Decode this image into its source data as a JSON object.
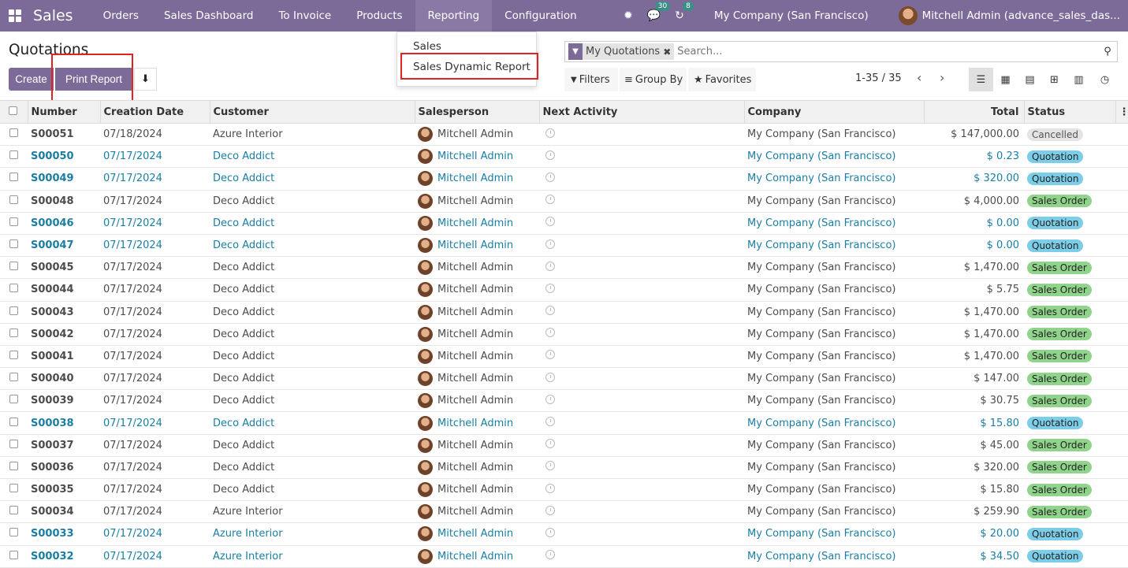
{
  "navbar": {
    "brand": "Sales",
    "menu": [
      "Orders",
      "Sales Dashboard",
      "To Invoice",
      "Products",
      "Reporting",
      "Configuration"
    ],
    "active_menu": "Reporting",
    "messages_count": "30",
    "activities_count": "8",
    "company": "My Company (San Francisco)",
    "user": "Mitchell Admin (advance_sales_das..."
  },
  "page": {
    "title": "Quotations",
    "create_label": "Create",
    "print_label": "Print Report"
  },
  "reporting_menu": {
    "items": [
      "Sales",
      "Sales Dynamic Report"
    ]
  },
  "search": {
    "facet": "My Quotations",
    "placeholder": "Search...",
    "filters_label": "Filters",
    "groupby_label": "Group By",
    "favorites_label": "Favorites"
  },
  "pager": {
    "text": "1-35 / 35"
  },
  "table": {
    "headers": [
      "Number",
      "Creation Date",
      "Customer",
      "Salesperson",
      "Next Activity",
      "Company",
      "Total",
      "Status"
    ],
    "rows": [
      {
        "number": "S00051",
        "date": "07/18/2024",
        "customer": "Azure Interior",
        "salesperson": "Mitchell Admin",
        "company": "My Company (San Francisco)",
        "total": "$ 147,000.00",
        "status": "Cancelled",
        "status_kind": "cancelled",
        "blue": false
      },
      {
        "number": "S00050",
        "date": "07/17/2024",
        "customer": "Deco Addict",
        "salesperson": "Mitchell Admin",
        "company": "My Company (San Francisco)",
        "total": "$ 0.23",
        "status": "Quotation",
        "status_kind": "quotation",
        "blue": true
      },
      {
        "number": "S00049",
        "date": "07/17/2024",
        "customer": "Deco Addict",
        "salesperson": "Mitchell Admin",
        "company": "My Company (San Francisco)",
        "total": "$ 320.00",
        "status": "Quotation",
        "status_kind": "quotation",
        "blue": true
      },
      {
        "number": "S00048",
        "date": "07/17/2024",
        "customer": "Deco Addict",
        "salesperson": "Mitchell Admin",
        "company": "My Company (San Francisco)",
        "total": "$ 4,000.00",
        "status": "Sales Order",
        "status_kind": "order",
        "blue": false
      },
      {
        "number": "S00046",
        "date": "07/17/2024",
        "customer": "Deco Addict",
        "salesperson": "Mitchell Admin",
        "company": "My Company (San Francisco)",
        "total": "$ 0.00",
        "status": "Quotation",
        "status_kind": "quotation",
        "blue": true
      },
      {
        "number": "S00047",
        "date": "07/17/2024",
        "customer": "Deco Addict",
        "salesperson": "Mitchell Admin",
        "company": "My Company (San Francisco)",
        "total": "$ 0.00",
        "status": "Quotation",
        "status_kind": "quotation",
        "blue": true
      },
      {
        "number": "S00045",
        "date": "07/17/2024",
        "customer": "Deco Addict",
        "salesperson": "Mitchell Admin",
        "company": "My Company (San Francisco)",
        "total": "$ 1,470.00",
        "status": "Sales Order",
        "status_kind": "order",
        "blue": false
      },
      {
        "number": "S00044",
        "date": "07/17/2024",
        "customer": "Deco Addict",
        "salesperson": "Mitchell Admin",
        "company": "My Company (San Francisco)",
        "total": "$ 5.75",
        "status": "Sales Order",
        "status_kind": "order",
        "blue": false
      },
      {
        "number": "S00043",
        "date": "07/17/2024",
        "customer": "Deco Addict",
        "salesperson": "Mitchell Admin",
        "company": "My Company (San Francisco)",
        "total": "$ 1,470.00",
        "status": "Sales Order",
        "status_kind": "order",
        "blue": false
      },
      {
        "number": "S00042",
        "date": "07/17/2024",
        "customer": "Deco Addict",
        "salesperson": "Mitchell Admin",
        "company": "My Company (San Francisco)",
        "total": "$ 1,470.00",
        "status": "Sales Order",
        "status_kind": "order",
        "blue": false
      },
      {
        "number": "S00041",
        "date": "07/17/2024",
        "customer": "Deco Addict",
        "salesperson": "Mitchell Admin",
        "company": "My Company (San Francisco)",
        "total": "$ 1,470.00",
        "status": "Sales Order",
        "status_kind": "order",
        "blue": false
      },
      {
        "number": "S00040",
        "date": "07/17/2024",
        "customer": "Deco Addict",
        "salesperson": "Mitchell Admin",
        "company": "My Company (San Francisco)",
        "total": "$ 147.00",
        "status": "Sales Order",
        "status_kind": "order",
        "blue": false
      },
      {
        "number": "S00039",
        "date": "07/17/2024",
        "customer": "Deco Addict",
        "salesperson": "Mitchell Admin",
        "company": "My Company (San Francisco)",
        "total": "$ 30.75",
        "status": "Sales Order",
        "status_kind": "order",
        "blue": false
      },
      {
        "number": "S00038",
        "date": "07/17/2024",
        "customer": "Deco Addict",
        "salesperson": "Mitchell Admin",
        "company": "My Company (San Francisco)",
        "total": "$ 15.80",
        "status": "Quotation",
        "status_kind": "quotation",
        "blue": true
      },
      {
        "number": "S00037",
        "date": "07/17/2024",
        "customer": "Deco Addict",
        "salesperson": "Mitchell Admin",
        "company": "My Company (San Francisco)",
        "total": "$ 45.00",
        "status": "Sales Order",
        "status_kind": "order",
        "blue": false
      },
      {
        "number": "S00036",
        "date": "07/17/2024",
        "customer": "Deco Addict",
        "salesperson": "Mitchell Admin",
        "company": "My Company (San Francisco)",
        "total": "$ 320.00",
        "status": "Sales Order",
        "status_kind": "order",
        "blue": false
      },
      {
        "number": "S00035",
        "date": "07/17/2024",
        "customer": "Deco Addict",
        "salesperson": "Mitchell Admin",
        "company": "My Company (San Francisco)",
        "total": "$ 15.80",
        "status": "Sales Order",
        "status_kind": "order",
        "blue": false
      },
      {
        "number": "S00034",
        "date": "07/17/2024",
        "customer": "Azure Interior",
        "salesperson": "Mitchell Admin",
        "company": "My Company (San Francisco)",
        "total": "$ 259.90",
        "status": "Sales Order",
        "status_kind": "order",
        "blue": false
      },
      {
        "number": "S00033",
        "date": "07/17/2024",
        "customer": "Azure Interior",
        "salesperson": "Mitchell Admin",
        "company": "My Company (San Francisco)",
        "total": "$ 20.00",
        "status": "Quotation",
        "status_kind": "quotation",
        "blue": true
      },
      {
        "number": "S00032",
        "date": "07/17/2024",
        "customer": "Azure Interior",
        "salesperson": "Mitchell Admin",
        "company": "My Company (San Francisco)",
        "total": "$ 34.50",
        "status": "Quotation",
        "status_kind": "quotation",
        "blue": true
      }
    ]
  },
  "colors": {
    "brand": "#7c6a98",
    "link": "#1a7ea3",
    "highlight": "#e02424"
  }
}
